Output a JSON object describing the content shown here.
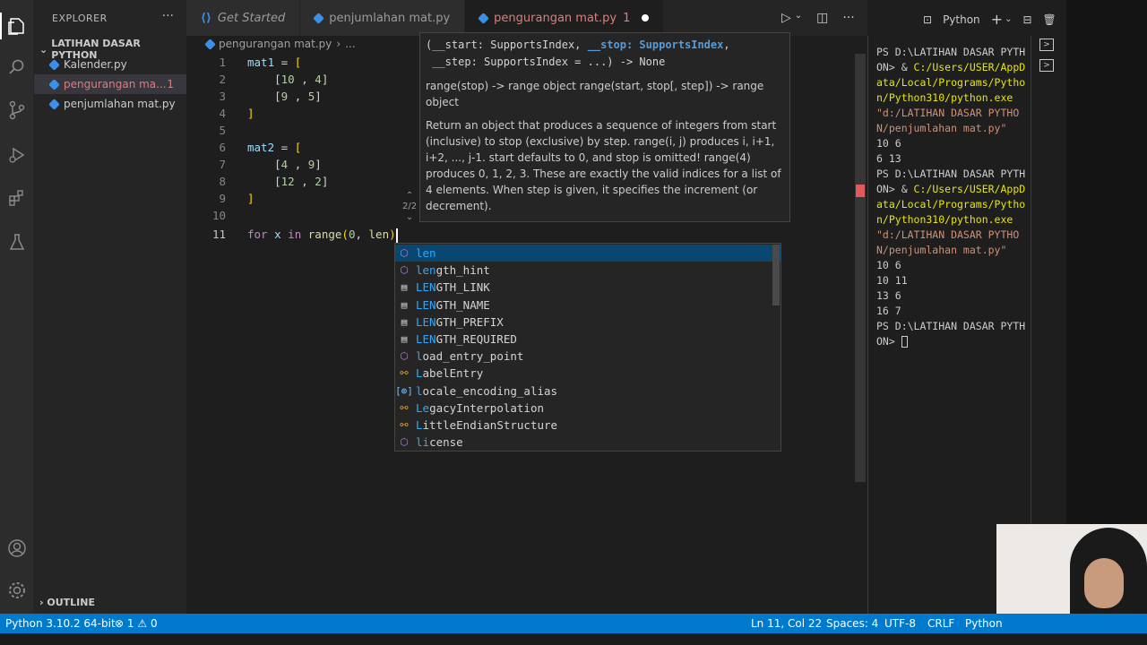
{
  "sidebar": {
    "title": "EXPLORER",
    "folder": "LATIHAN DASAR PYTHON",
    "files": [
      {
        "name": "Kalender.py"
      },
      {
        "name": "pengurangan ma...",
        "count": "1"
      },
      {
        "name": "penjumlahan mat.py"
      }
    ],
    "outline": "OUTLINE"
  },
  "tabs": [
    {
      "label": "Get Started"
    },
    {
      "label": "penjumlahan mat.py"
    },
    {
      "label": "pengurangan mat.py",
      "count": "1"
    }
  ],
  "breadcrumb": {
    "file": "pengurangan mat.py",
    "more": "..."
  },
  "editor": {
    "line_numbers": [
      "1",
      "2",
      "3",
      "4",
      "5",
      "6",
      "7",
      "8",
      "9",
      "10",
      "11"
    ]
  },
  "hover": {
    "signature_pre": "(__start: SupportsIndex, ",
    "signature_hl": "__stop: SupportsIndex",
    "signature_post": ",\n __step: SupportsIndex = ...) -> None",
    "summary": "range(stop) -> range object range(start, stop[, step]) -> range object",
    "description": "Return an object that produces a sequence of integers from start (inclusive) to stop (exclusive) by step. range(i, j) produces i, i+1, i+2, ..., j-1. start defaults to 0, and stop is omitted! range(4) produces 0, 1, 2, 3. These are exactly the valid indices for a list of 4 elements. When step is given, it specifies the increment (or decrement).",
    "counter": "2/2"
  },
  "suggest": [
    {
      "pre": "",
      "match": "len",
      "rest": "",
      "kind": "cube"
    },
    {
      "pre": "",
      "match": "len",
      "rest": "gth_hint",
      "kind": "cube"
    },
    {
      "pre": "",
      "match": "LEN",
      "rest": "GTH_LINK",
      "kind": "enum"
    },
    {
      "pre": "",
      "match": "LEN",
      "rest": "GTH_NAME",
      "kind": "enum"
    },
    {
      "pre": "",
      "match": "LEN",
      "rest": "GTH_PREFIX",
      "kind": "enum"
    },
    {
      "pre": "",
      "match": "LEN",
      "rest": "GTH_REQUIRED",
      "kind": "enum"
    },
    {
      "pre": "",
      "match": "l",
      "rest": "oad_entry_point",
      "kind": "cube"
    },
    {
      "pre": "",
      "match": "L",
      "rest": "abelEntry",
      "kind": "class"
    },
    {
      "pre": "",
      "match": "l",
      "rest": "ocale_encoding_alias",
      "kind": "var"
    },
    {
      "pre": "",
      "match": "Le",
      "rest": "gacyInterpolation",
      "kind": "class"
    },
    {
      "pre": "",
      "match": "L",
      "rest": "ittleEndianStructure",
      "kind": "class"
    },
    {
      "pre": "",
      "match": "li",
      "rest": "cense",
      "kind": "cube"
    }
  ],
  "terminal": {
    "header_label": "Python"
  },
  "status": {
    "interpreter": "Python 3.10.2 64-bit",
    "errors": "1",
    "warnings": "0",
    "position": "Ln 11, Col 22",
    "spaces": "Spaces: 4",
    "encoding": "UTF-8",
    "eol": "CRLF",
    "language": "Python"
  },
  "colors": {
    "accent": "#007acc",
    "error": "#e07c7c",
    "selection": "#094771"
  }
}
